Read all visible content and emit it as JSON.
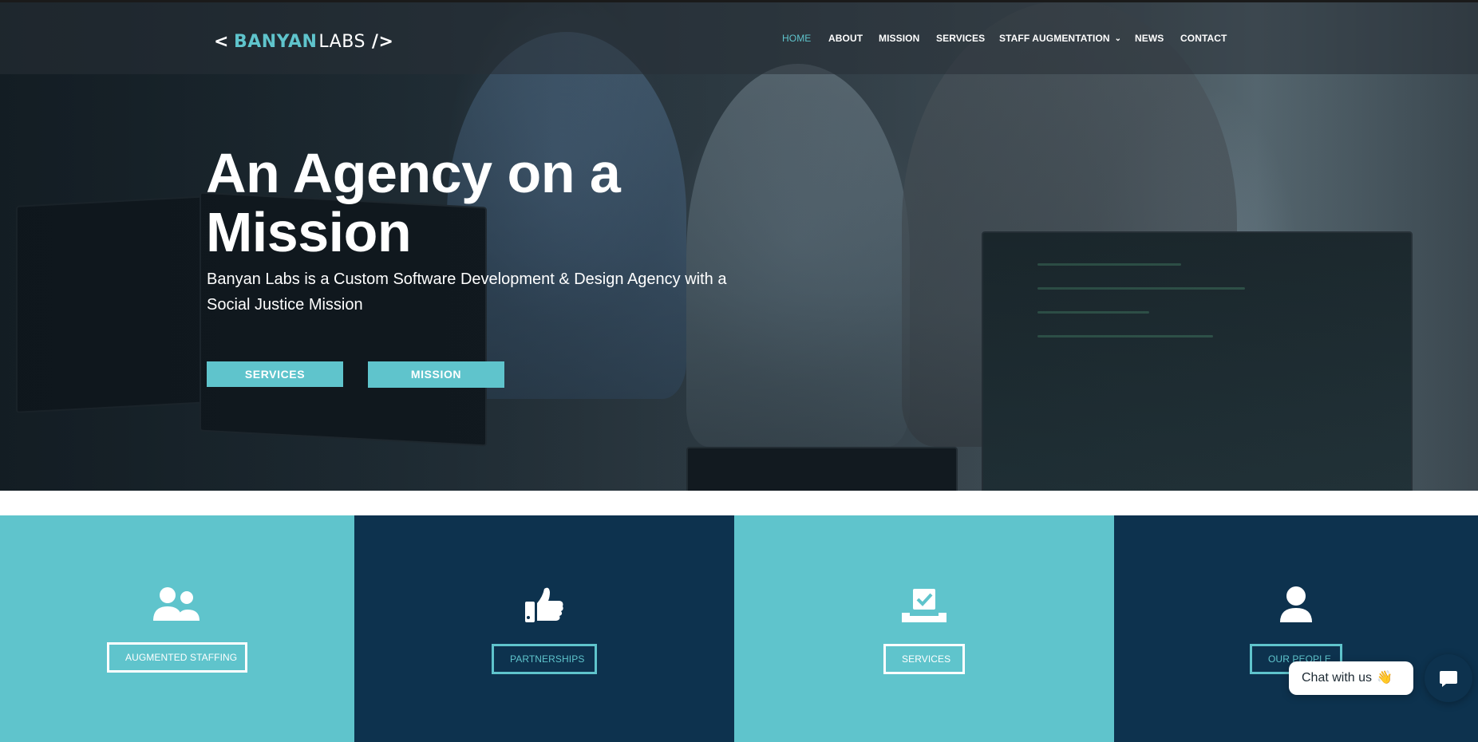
{
  "brand": {
    "logo_chevron": "<",
    "logo_word1": "BANYAN",
    "logo_word2": "LABS",
    "logo_slash": "/>"
  },
  "nav": {
    "items": [
      {
        "label": "HOME",
        "active": true
      },
      {
        "label": "ABOUT"
      },
      {
        "label": "MISSION"
      },
      {
        "label": "SERVICES"
      },
      {
        "label": "STAFF AUGMENTATION",
        "has_dropdown": true
      },
      {
        "label": "NEWS"
      },
      {
        "label": "CONTACT"
      }
    ],
    "dropdown_icon": "chevron-down-icon"
  },
  "hero": {
    "title": "An Agency on a Mission",
    "subtitle": "Banyan Labs is a Custom Software Development & Design Agency with a Social Justice Mission",
    "buttons": [
      {
        "label": "SERVICES"
      },
      {
        "label": "MISSION"
      }
    ]
  },
  "features": [
    {
      "label": "AUGMENTED STAFFING",
      "icon": "users-icon",
      "theme": "teal"
    },
    {
      "label": "PARTNERSHIPS",
      "icon": "thumbs-up-icon",
      "theme": "navy"
    },
    {
      "label": "SERVICES",
      "icon": "checkbox-tray-icon",
      "theme": "teal"
    },
    {
      "label": "OUR PEOPLE",
      "icon": "user-icon",
      "theme": "navy"
    }
  ],
  "chat": {
    "label": "Chat with us",
    "emoji": "👋",
    "icon": "chat-bubble-icon"
  },
  "colors": {
    "accent": "#5fc4cc",
    "navy": "#0d324e",
    "white": "#ffffff"
  }
}
